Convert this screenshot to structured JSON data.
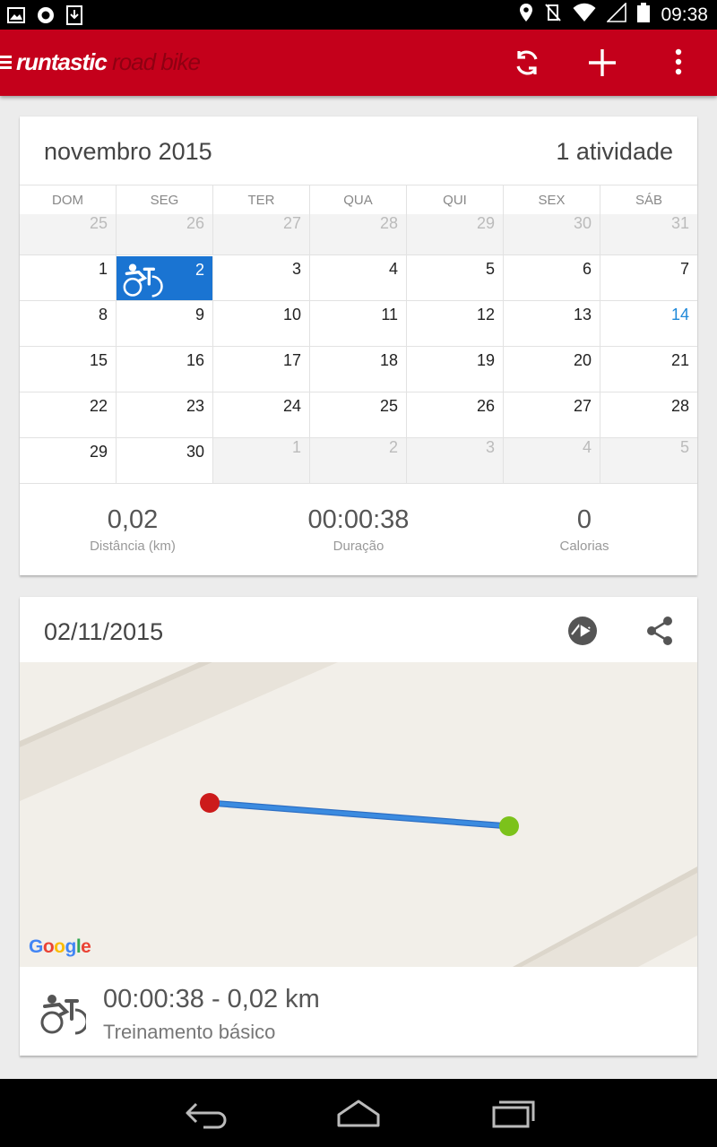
{
  "status_bar": {
    "time": "09:38",
    "left_icons": [
      "image-icon",
      "circle-notification-icon",
      "download-icon"
    ],
    "right_icons": [
      "location-icon",
      "vibrate-off-icon",
      "wifi-icon",
      "signal-icon",
      "battery-icon"
    ]
  },
  "app_bar": {
    "brand_part1": "runtastic",
    "brand_part2": "road bike",
    "actions": [
      "sync-icon",
      "add-icon",
      "overflow-menu-icon"
    ],
    "accent_color": "#c4001b"
  },
  "calendar": {
    "month_label": "novembro 2015",
    "activity_count": "1 atividade",
    "weekdays": [
      "DOM",
      "SEG",
      "TER",
      "QUA",
      "QUI",
      "SEX",
      "SÁB"
    ],
    "weeks": [
      [
        {
          "d": "25",
          "o": true
        },
        {
          "d": "26",
          "o": true
        },
        {
          "d": "27",
          "o": true
        },
        {
          "d": "28",
          "o": true
        },
        {
          "d": "29",
          "o": true
        },
        {
          "d": "30",
          "o": true
        },
        {
          "d": "31",
          "o": true
        }
      ],
      [
        {
          "d": "1"
        },
        {
          "d": "2",
          "sel": true
        },
        {
          "d": "3"
        },
        {
          "d": "4"
        },
        {
          "d": "5"
        },
        {
          "d": "6"
        },
        {
          "d": "7"
        }
      ],
      [
        {
          "d": "8"
        },
        {
          "d": "9"
        },
        {
          "d": "10"
        },
        {
          "d": "11"
        },
        {
          "d": "12"
        },
        {
          "d": "13"
        },
        {
          "d": "14",
          "today": true
        }
      ],
      [
        {
          "d": "15"
        },
        {
          "d": "16"
        },
        {
          "d": "17"
        },
        {
          "d": "18"
        },
        {
          "d": "19"
        },
        {
          "d": "20"
        },
        {
          "d": "21"
        }
      ],
      [
        {
          "d": "22"
        },
        {
          "d": "23"
        },
        {
          "d": "24"
        },
        {
          "d": "25"
        },
        {
          "d": "26"
        },
        {
          "d": "27"
        },
        {
          "d": "28"
        }
      ],
      [
        {
          "d": "29"
        },
        {
          "d": "30"
        },
        {
          "d": "1",
          "o": true
        },
        {
          "d": "2",
          "o": true
        },
        {
          "d": "3",
          "o": true
        },
        {
          "d": "4",
          "o": true
        },
        {
          "d": "5",
          "o": true
        }
      ]
    ],
    "selected_color": "#1a74d2",
    "today_color": "#1e88d9"
  },
  "stats": {
    "distance_value": "0,02",
    "distance_label": "Distância (km)",
    "duration_value": "00:00:38",
    "duration_label": "Duração",
    "calories_value": "0",
    "calories_label": "Calorias"
  },
  "activity": {
    "date": "02/11/2015",
    "header_icons": [
      "replay-play-icon",
      "share-icon"
    ],
    "map_attribution": "Google",
    "route_start_color": "#cc1b1b",
    "route_end_color": "#7cc21b",
    "route_color": "#3b8be0",
    "summary": "00:00:38 - 0,02 km",
    "type": "Treinamento básico"
  },
  "nav_bar": {
    "buttons": [
      "back-icon",
      "home-icon",
      "recents-icon"
    ]
  }
}
